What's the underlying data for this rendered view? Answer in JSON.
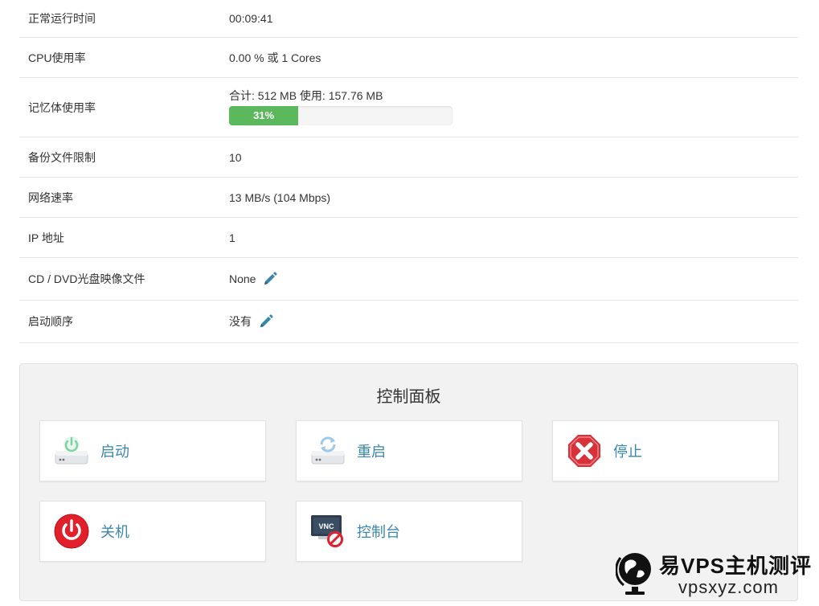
{
  "info": {
    "rows": [
      {
        "label": "正常运行时间",
        "value": "00:09:41"
      },
      {
        "label": "CPU使用率",
        "value": "0.00 % 或 1 Cores"
      },
      {
        "label": "记忆体使用率",
        "value": "合计: 512 MB 使用: 157.76 MB",
        "progress_label": "31%",
        "progress_percent": 31
      },
      {
        "label": "备份文件限制",
        "value": "10"
      },
      {
        "label": "网络速率",
        "value": "13 MB/s (104 Mbps)"
      },
      {
        "label": "IP 地址",
        "value": "1"
      },
      {
        "label": "CD / DVD光盘映像文件",
        "value": "None"
      },
      {
        "label": "启动顺序",
        "value": "没有"
      }
    ]
  },
  "control_panel": {
    "title": "控制面板",
    "buttons": [
      {
        "label": "启动",
        "icon": "power-on-drive-icon"
      },
      {
        "label": "重启",
        "icon": "restart-drive-icon"
      },
      {
        "label": "停止",
        "icon": "stop-icon"
      },
      {
        "label": "关机",
        "icon": "shutdown-icon"
      },
      {
        "label": "控制台",
        "icon": "vnc-console-icon"
      }
    ]
  },
  "watermark": {
    "brand": "易VPS主机测评",
    "url": "vpsxyz.com"
  },
  "colors": {
    "link": "#3a87ad",
    "progress": "#5cb85c",
    "stop_red": "#d9313a",
    "edit_blue": "#3a87ad"
  }
}
